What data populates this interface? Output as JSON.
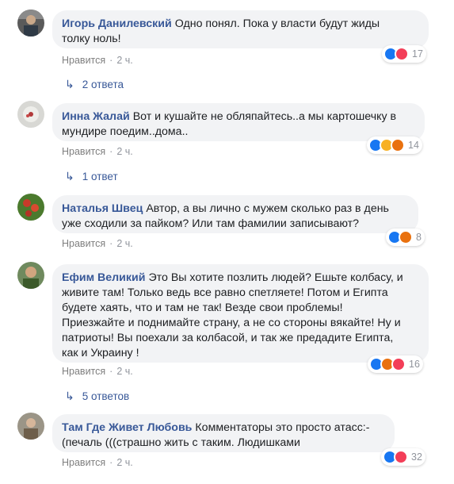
{
  "comments": [
    {
      "author": "Игорь Данилевский",
      "text": "Одно понял. Пока у власти будут жиды",
      "text2": "толку ноль!",
      "like_label": "Нравится",
      "time": "2 ч.",
      "reaction_count": "17",
      "reactions": [
        "like-icon",
        "love-icon"
      ],
      "replies_label": "2 ответа"
    },
    {
      "author": "Инна Жалай",
      "text": "Вот и кушайте не обляпайтесь..а мы картошечку в",
      "text2": "мундире поедим..дома..",
      "like_label": "Нравится",
      "time": "2 ч.",
      "reaction_count": "14",
      "reactions": [
        "like-icon",
        "haha-icon",
        "angry-icon"
      ],
      "replies_label": "1 ответ"
    },
    {
      "author": "Наталья Швец",
      "text": "Автор, а вы лично с мужем сколько раз в день",
      "text2": "уже сходили за пайком? Или там фамилии записывают?",
      "like_label": "Нравится",
      "time": "2 ч.",
      "reaction_count": "8",
      "reactions": [
        "like-icon",
        "angry-icon"
      ]
    },
    {
      "author": "Ефим Великий",
      "lines": [
        "Это Вы хотите позлить людей? Ешьте колбасу, и",
        "живите там! Только ведь все равно спетляете! Потом и Египта",
        "будете хаять, что и там не так! Везде свои проблемы!",
        "Приезжайте и поднимайте страну, а не со стороны вякайте! Ну и",
        "патриоты! Вы поехали за колбасой, и так же предадите Египта,",
        "как и Украину !"
      ],
      "like_label": "Нравится",
      "time": "2 ч.",
      "reaction_count": "16",
      "reactions": [
        "like-icon",
        "angry-icon",
        "love-icon"
      ],
      "replies_label": "5 ответов"
    },
    {
      "author": "Там Где Живет Любовь",
      "text": "Комментаторы это просто атасс:-",
      "text2": "(печаль (((страшно жить с таким. Людишками",
      "like_label": "Нравится",
      "time": "2 ч.",
      "reaction_count": "32",
      "reactions": [
        "like-icon",
        "love-icon"
      ]
    }
  ],
  "colors": {
    "author": "#385898",
    "bubble": "#f2f3f5",
    "meta": "#90949c",
    "like": "#1877f2",
    "love": "#f33e58",
    "haha": "#f7b125",
    "angry": "#e9710f"
  }
}
